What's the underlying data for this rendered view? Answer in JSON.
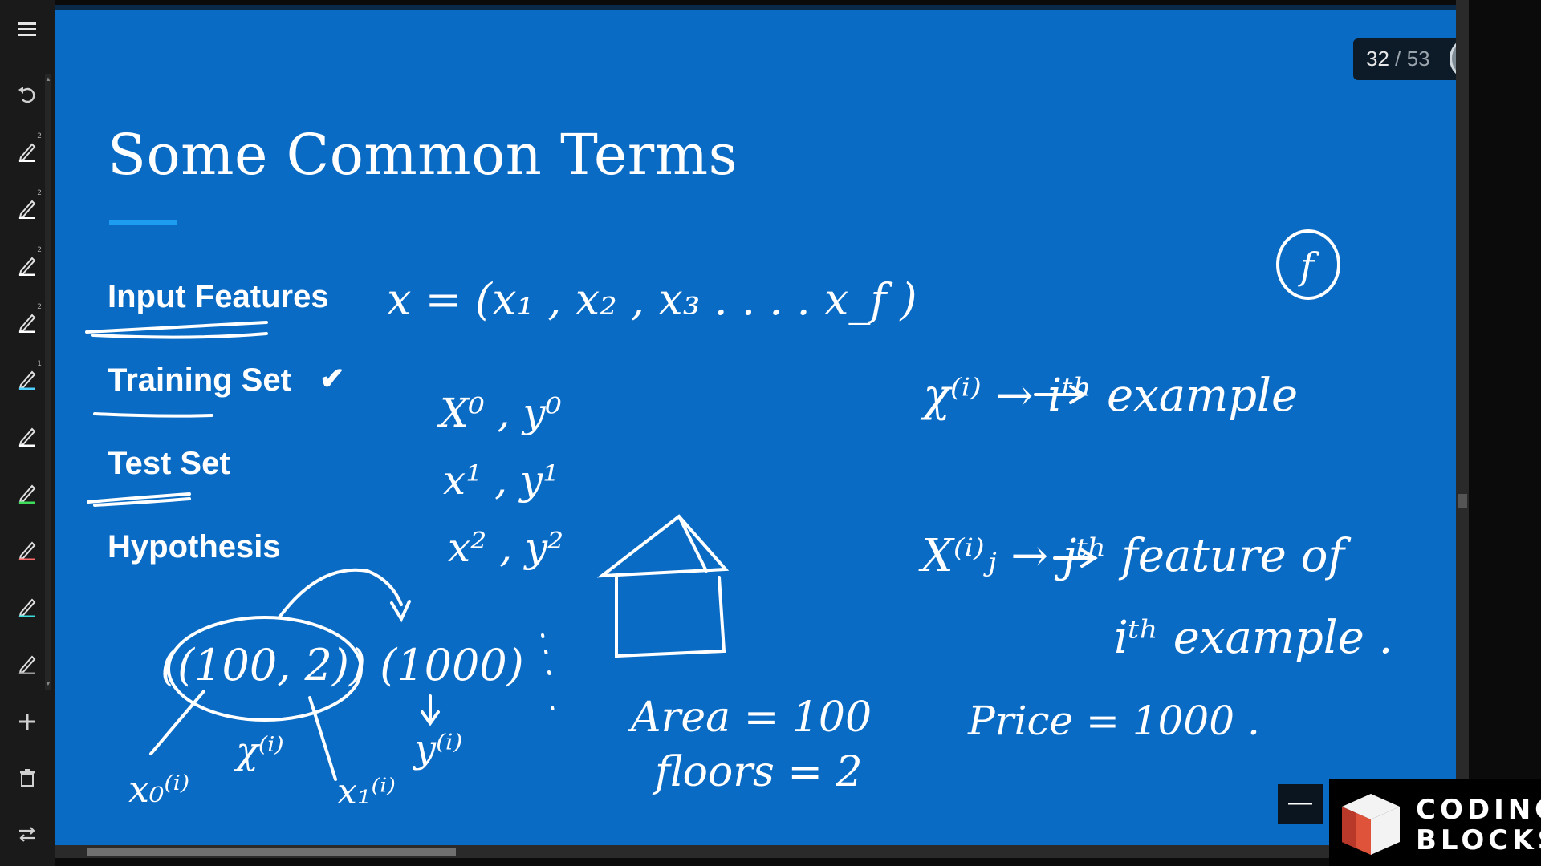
{
  "toolbar": {
    "items": [
      {
        "name": "menu-icon",
        "glyph": "≡"
      },
      {
        "name": "undo-icon",
        "glyph": "↶"
      },
      {
        "name": "pen-icon",
        "color": "#ffffff",
        "size": "2"
      },
      {
        "name": "pen-icon",
        "color": "#ffffff",
        "size": "2"
      },
      {
        "name": "pen-icon",
        "color": "#ffffff",
        "size": "2"
      },
      {
        "name": "pen-icon",
        "color": "#ffffff",
        "size": "2"
      },
      {
        "name": "pen-icon",
        "color": "#4dd0ff",
        "size": "1"
      },
      {
        "name": "pen-icon",
        "color": "#ffffff",
        "size": ""
      },
      {
        "name": "pen-icon",
        "color": "#3ddc5a",
        "size": ""
      },
      {
        "name": "pen-icon",
        "color": "#ff6a6a",
        "size": ""
      },
      {
        "name": "pen-icon",
        "color": "#3ddcdc",
        "size": ""
      },
      {
        "name": "pen-icon",
        "color": "#9a9a9a",
        "size": ""
      },
      {
        "name": "plus-icon",
        "glyph": "+"
      },
      {
        "name": "trash-icon",
        "glyph": "🗑"
      },
      {
        "name": "swap-icon",
        "glyph": "⇆"
      }
    ]
  },
  "slide": {
    "title": "Some Common Terms",
    "terms": [
      "Input Features",
      "Training Set",
      "Test Set",
      "Hypothesis"
    ],
    "checkmark": "✔",
    "counter": {
      "current": "32",
      "separator": "/",
      "total": "53"
    },
    "minimize_label": "—"
  },
  "annotations": {
    "feature_vector": "x = (x₁ , x₂ , x₃ . . . . x_f )",
    "f_circle": "f",
    "training_pairs": [
      "X⁰ , y⁰",
      "x¹ , y¹",
      "x² , y²"
    ],
    "example_pair": "((100, 2)) (1000)",
    "area_label": "Area = 100",
    "floors_label": "floors = 2",
    "x_i_def": "χ⁽ⁱ⁾ → iᵗʰ example",
    "x_j_def_line1": "X⁽ⁱ⁾ⱼ → jᵗʰ feature of",
    "x_j_def_line2": "iᵗʰ example .",
    "price_label": "Price = 1000 ."
  },
  "logo": {
    "line1": "CODING",
    "line2": "BLOCKS",
    "colors": {
      "top": "#f3f3f3",
      "left": "#e0533b",
      "right": "#b8382a"
    }
  },
  "colors": {
    "slide_bg": "#0a6bc4",
    "accent": "#1e9cf0"
  }
}
